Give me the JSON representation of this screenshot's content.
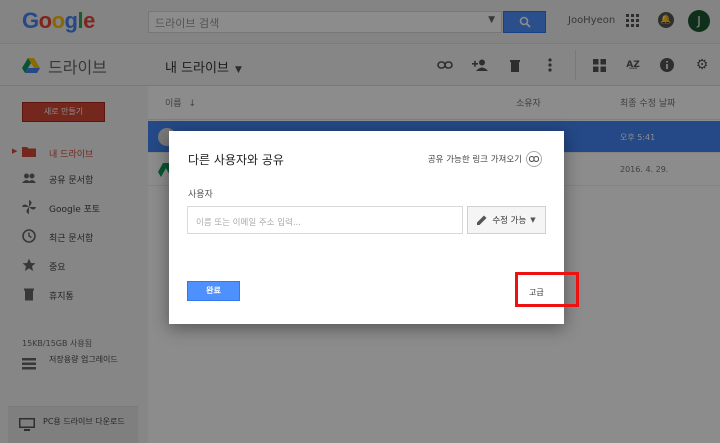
{
  "header": {
    "logo_letters": [
      "G",
      "o",
      "o",
      "g",
      "l",
      "e"
    ],
    "logo_colors": [
      "#4285f4",
      "#ea4335",
      "#fbbc05",
      "#4285f4",
      "#34a853",
      "#ea4335"
    ],
    "search_placeholder": "드라이브 검색",
    "user_name": "JooHyeon",
    "avatar_letter": "J"
  },
  "subbar": {
    "app_name": "드라이브",
    "folder_title": "내 드라이브"
  },
  "sidebar": {
    "new_button": "새로 만들기",
    "items": [
      {
        "label": "내 드라이브",
        "icon": "folder-drive-icon"
      },
      {
        "label": "공유 문서함",
        "icon": "people-icon"
      },
      {
        "label": "Google 포토",
        "icon": "photos-pinwheel-icon"
      },
      {
        "label": "최근 문서함",
        "icon": "clock-icon"
      },
      {
        "label": "중요",
        "icon": "star-icon"
      },
      {
        "label": "휴지통",
        "icon": "trash-icon"
      }
    ],
    "storage": "15KB/15GB 사용됨",
    "upgrade": "저장용량 업그레이드",
    "pc_download": "PC용 드라이브 다운로드"
  },
  "filelist": {
    "col_name": "이름",
    "col_owner": "소유자",
    "col_modified": "최종 수정 날짜",
    "rows": [
      {
        "modified": "오후 5:41",
        "selected": true
      },
      {
        "modified": "2016. 4. 29.",
        "selected": false
      }
    ]
  },
  "dialog": {
    "title": "다른 사용자와 공유",
    "get_link": "공유 가능한 링크 가져오기",
    "people_label": "사용자",
    "input_placeholder": "이름 또는 이메일 주소 입력...",
    "permission": "수정 가능",
    "done_button": "완료",
    "advanced_link": "고급"
  },
  "colors": {
    "accent_blue": "#4d90fe",
    "new_red": "#d14836",
    "highlight_red": "#ee1111",
    "selected_row": "#4285f4"
  }
}
